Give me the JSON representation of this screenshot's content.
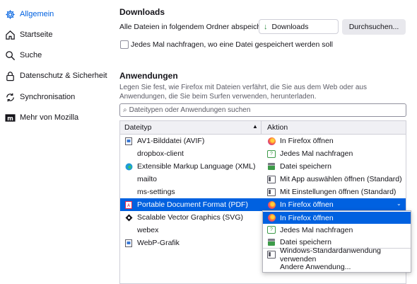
{
  "sidebar": {
    "items": [
      {
        "label": "Allgemein",
        "icon": "gear-icon",
        "active": true
      },
      {
        "label": "Startseite",
        "icon": "home-icon"
      },
      {
        "label": "Suche",
        "icon": "search-icon"
      },
      {
        "label": "Datenschutz & Sicherheit",
        "icon": "lock-icon"
      },
      {
        "label": "Synchronisation",
        "icon": "sync-icon"
      },
      {
        "label": "Mehr von Mozilla",
        "icon": "mozilla-icon"
      }
    ]
  },
  "downloads": {
    "heading": "Downloads",
    "save_label": "Alle Dateien in folgendem Ordner abspeichern:",
    "folder_value": "Downloads",
    "browse_button": "Durchsuchen...",
    "ask_label": "Jedes Mal nachfragen, wo eine Datei gespeichert werden soll",
    "ask_checked": false
  },
  "applications": {
    "heading": "Anwendungen",
    "description": "Legen Sie fest, wie Firefox mit Dateien verfährt, die Sie aus dem Web oder aus Anwendungen, die Sie beim Surfen verwenden, herunterladen.",
    "search_placeholder": "Dateitypen oder Anwendungen suchen",
    "col_type": "Dateityp",
    "col_action": "Aktion",
    "rows": [
      {
        "type": "AV1-Bilddatei (AVIF)",
        "type_icon": "file-icon",
        "action": "In Firefox öffnen",
        "action_icon": "firefox-icon"
      },
      {
        "type": "dropbox-client",
        "type_icon": "",
        "action": "Jedes Mal nachfragen",
        "action_icon": "ask-icon"
      },
      {
        "type": "Extensible Markup Language (XML)",
        "type_icon": "edge-icon",
        "action": "Datei speichern",
        "action_icon": "save-icon"
      },
      {
        "type": "mailto",
        "type_icon": "",
        "action": "Mit App auswählen öffnen (Standard)",
        "action_icon": "app-icon"
      },
      {
        "type": "ms-settings",
        "type_icon": "",
        "action": "Mit Einstellungen öffnen (Standard)",
        "action_icon": "app-icon"
      },
      {
        "type": "Portable Document Format (PDF)",
        "type_icon": "pdf-icon",
        "action": "In Firefox öffnen",
        "action_icon": "firefox-icon",
        "selected": true
      },
      {
        "type": "Scalable Vector Graphics (SVG)",
        "type_icon": "svg-icon",
        "action": "",
        "action_icon": ""
      },
      {
        "type": "webex",
        "type_icon": "",
        "action": "",
        "action_icon": ""
      },
      {
        "type": "WebP-Grafik",
        "type_icon": "file-icon",
        "action": "",
        "action_icon": ""
      }
    ],
    "dropdown_options": [
      {
        "label": "In Firefox öffnen",
        "icon": "firefox-icon",
        "highlighted": true
      },
      {
        "label": "Jedes Mal nachfragen",
        "icon": "ask-icon"
      },
      {
        "label": "Datei speichern",
        "icon": "save-icon"
      },
      {
        "label": "Windows-Standardanwendung verwenden",
        "icon": "app-icon"
      },
      {
        "label": "Andere Anwendung...",
        "icon": ""
      }
    ]
  },
  "colors": {
    "accent": "#0061e0",
    "selected_row": "#0061e0"
  }
}
